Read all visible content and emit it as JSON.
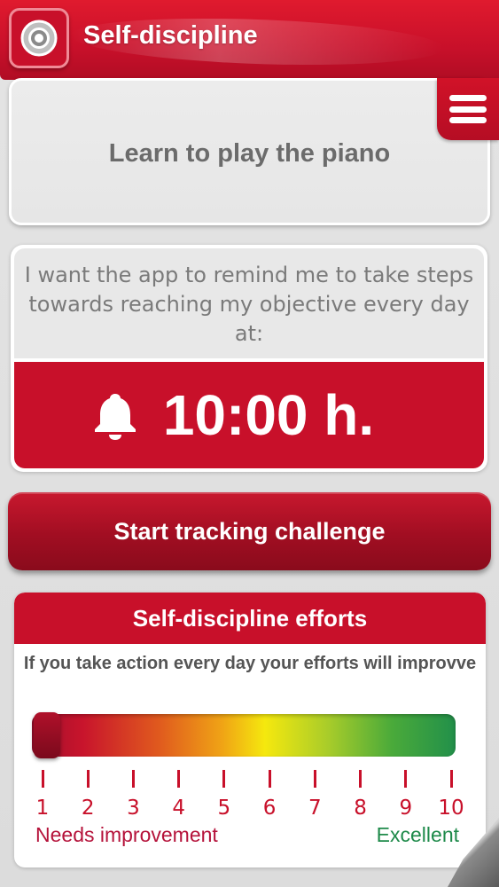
{
  "header": {
    "title": "Self-discipline",
    "logo_icon": "target-icon",
    "menu_icon": "hamburger-menu-icon",
    "color": "#c8102a"
  },
  "objective": {
    "text": "Learn to play the piano"
  },
  "reminder": {
    "text": "I want the app to remind me to take steps towards reaching my objective every day at:",
    "time": "10:00 h.",
    "icon": "bell-icon"
  },
  "actions": {
    "start_label": "Start tracking challenge"
  },
  "efforts": {
    "title": "Self-discipline efforts",
    "description": "If you take action every day your efforts will improvve",
    "scale": [
      "1",
      "2",
      "3",
      "4",
      "5",
      "6",
      "7",
      "8",
      "9",
      "10"
    ],
    "current_level": 1,
    "low_label": "Needs improvement",
    "high_label": "Excellent",
    "low_color": "#b5123a",
    "high_color": "#1e8a4a"
  }
}
